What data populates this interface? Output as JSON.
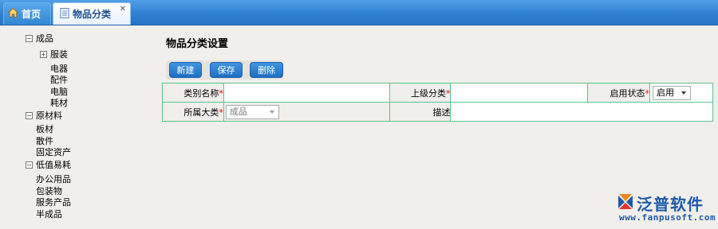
{
  "tabs": {
    "home": {
      "label": "首页",
      "icon": "home-icon"
    },
    "active": {
      "label": "物品分类",
      "icon": "page-icon",
      "close_icon": "close-icon"
    }
  },
  "tree": {
    "groups": [
      {
        "label": "成品",
        "expanded": true,
        "children": [
          {
            "label": "服装",
            "has_children": true,
            "expanded": false
          },
          {
            "label": "电器"
          },
          {
            "label": "配件"
          },
          {
            "label": "电脑"
          },
          {
            "label": "耗材"
          }
        ]
      },
      {
        "label": "原材料",
        "expanded": true,
        "children": [
          {
            "label": "板材"
          },
          {
            "label": "散件"
          },
          {
            "label": "固定资产"
          }
        ]
      },
      {
        "label": "低值易耗",
        "expanded": true,
        "children": [
          {
            "label": "办公用品"
          },
          {
            "label": "包装物"
          },
          {
            "label": "服务产品"
          },
          {
            "label": "半成品"
          }
        ]
      }
    ]
  },
  "page": {
    "title": "物品分类设置"
  },
  "toolbar": {
    "new_label": "新建",
    "save_label": "保存",
    "delete_label": "删除"
  },
  "form": {
    "category_name": {
      "label": "类别名称",
      "required_mark": "*",
      "value": ""
    },
    "parent_category": {
      "label": "上级分类",
      "required_mark": "*",
      "value": ""
    },
    "status": {
      "label": "启用状态",
      "required_mark": "*",
      "value": "启用"
    },
    "main_category": {
      "label": "所属大类",
      "required_mark": "*",
      "value": "成品"
    },
    "description": {
      "label": "描述",
      "value": ""
    }
  },
  "branding": {
    "name": "泛普软件",
    "url": "www.fanpusoft.com",
    "color": "#1e5aa8"
  },
  "colors": {
    "tab_bar": "#2f82d2",
    "button": "#2a80d2",
    "table_border": "#58c48a",
    "required": "#ee0000"
  }
}
